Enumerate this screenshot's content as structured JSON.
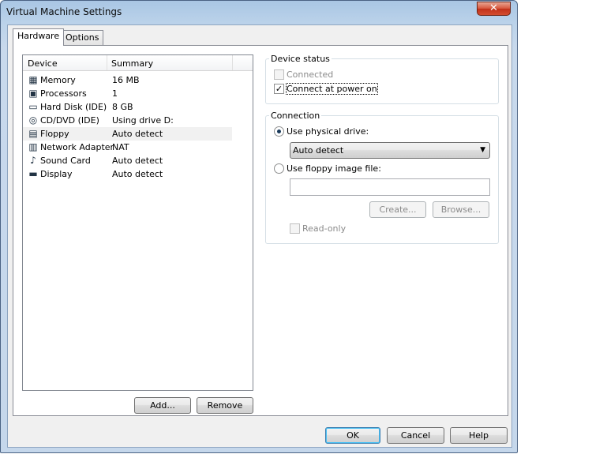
{
  "window": {
    "title": "Virtual Machine Settings",
    "close_glyph": "✕"
  },
  "tabs": [
    {
      "label": "Hardware",
      "active": true
    },
    {
      "label": "Options",
      "active": false
    }
  ],
  "device_list": {
    "headers": {
      "device": "Device",
      "summary": "Summary"
    },
    "rows": [
      {
        "icon": "memory-icon",
        "name": "Memory",
        "summary": "16 MB",
        "selected": false
      },
      {
        "icon": "processor-icon",
        "name": "Processors",
        "summary": "1",
        "selected": false
      },
      {
        "icon": "hard-disk-icon",
        "name": "Hard Disk (IDE)",
        "summary": "8 GB",
        "selected": false
      },
      {
        "icon": "cd-dvd-icon",
        "name": "CD/DVD (IDE)",
        "summary": "Using drive D:",
        "selected": false
      },
      {
        "icon": "floppy-icon",
        "name": "Floppy",
        "summary": "Auto detect",
        "selected": true
      },
      {
        "icon": "network-adapter-icon",
        "name": "Network Adapter",
        "summary": "NAT",
        "selected": false
      },
      {
        "icon": "sound-card-icon",
        "name": "Sound Card",
        "summary": "Auto detect",
        "selected": false
      },
      {
        "icon": "display-icon",
        "name": "Display",
        "summary": "Auto detect",
        "selected": false
      }
    ]
  },
  "list_buttons": {
    "add": "Add...",
    "remove": "Remove"
  },
  "device_status": {
    "label": "Device status",
    "connected": {
      "label": "Connected",
      "checked": false,
      "enabled": false
    },
    "connect_at_power_on": {
      "label": "Connect at power on",
      "checked": true,
      "enabled": true
    }
  },
  "connection": {
    "label": "Connection",
    "use_physical_drive": {
      "label": "Use physical drive:",
      "selected": true
    },
    "drive_select": {
      "value": "Auto detect"
    },
    "use_floppy_image": {
      "label": "Use floppy image file:",
      "selected": false
    },
    "image_path": {
      "value": ""
    },
    "create_button": "Create...",
    "browse_button": "Browse...",
    "read_only": {
      "label": "Read-only",
      "checked": false,
      "enabled": false
    }
  },
  "footer": {
    "ok": "OK",
    "cancel": "Cancel",
    "help": "Help"
  },
  "colors": {
    "selected_row": "#f1f1f1",
    "title_bar": "#bcd3ea",
    "close_button": "#d6543a"
  }
}
